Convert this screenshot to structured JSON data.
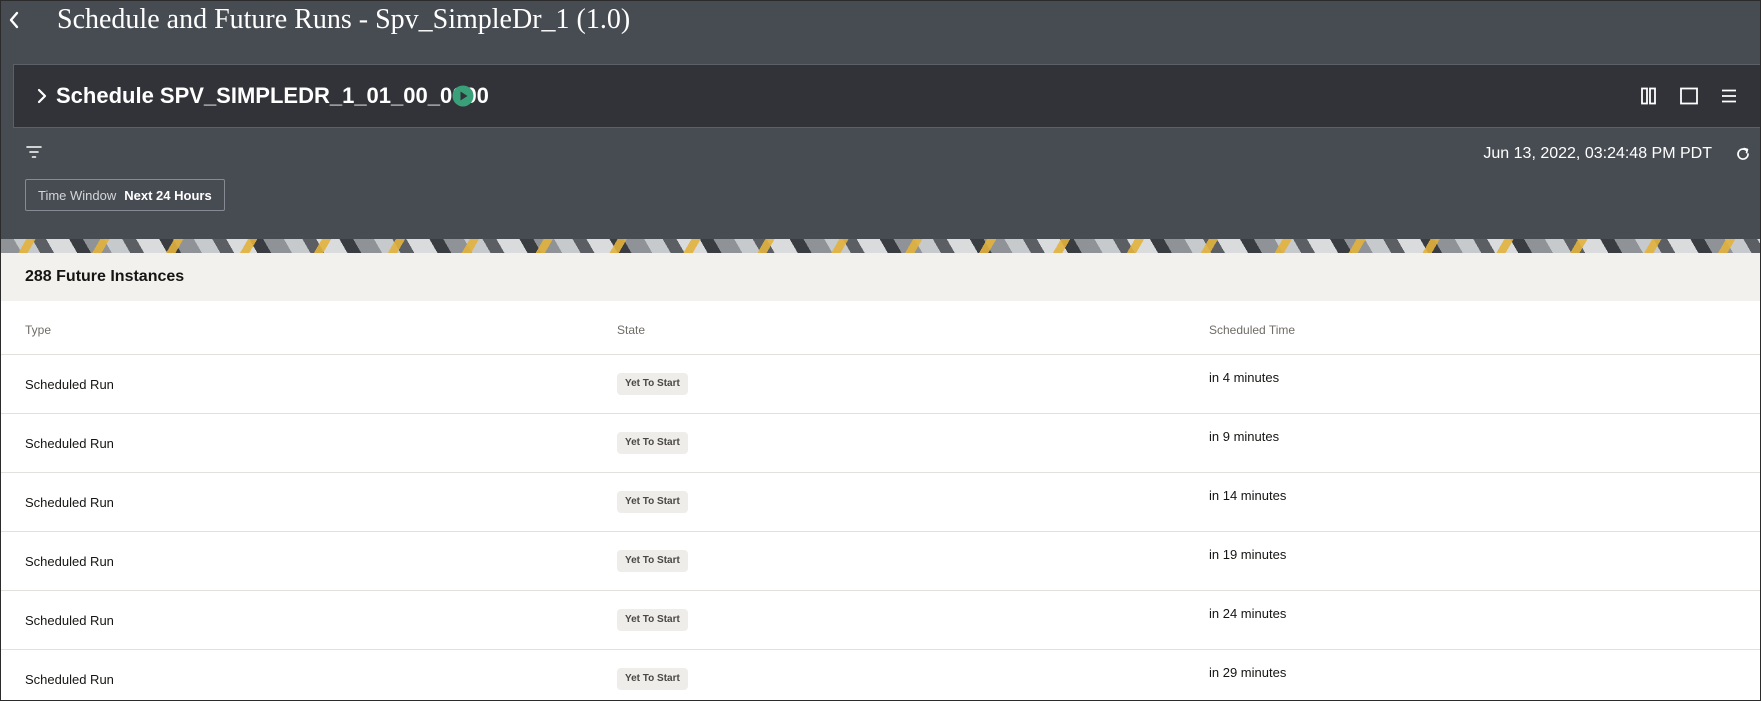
{
  "header": {
    "title": "Schedule and Future Runs - Spv_SimpleDr_1 (1.0)",
    "back_icon": "chevron-left-icon"
  },
  "schedule": {
    "name": "Schedule SPV_SIMPLEDR_1_01_00_0000",
    "status_icon": "play-circle-icon",
    "status_color": "#3aa079"
  },
  "toolbar": {
    "timestamp": "Jun 13, 2022, 03:24:48 PM PDT",
    "time_window_label": "Time Window",
    "time_window_value": "Next 24 Hours"
  },
  "instances": {
    "count_label": "288 Future Instances"
  },
  "table": {
    "columns": [
      "Type",
      "State",
      "Scheduled Time"
    ],
    "rows": [
      {
        "type": "Scheduled Run",
        "state": "Yet To Start",
        "time": "in 4 minutes"
      },
      {
        "type": "Scheduled Run",
        "state": "Yet To Start",
        "time": "in 9 minutes"
      },
      {
        "type": "Scheduled Run",
        "state": "Yet To Start",
        "time": "in 14 minutes"
      },
      {
        "type": "Scheduled Run",
        "state": "Yet To Start",
        "time": "in 19 minutes"
      },
      {
        "type": "Scheduled Run",
        "state": "Yet To Start",
        "time": "in 24 minutes"
      },
      {
        "type": "Scheduled Run",
        "state": "Yet To Start",
        "time": "in 29 minutes"
      }
    ]
  },
  "colors": {
    "header_bg": "#474b52",
    "bar_bg": "#313338",
    "accent_green": "#3aa079"
  }
}
